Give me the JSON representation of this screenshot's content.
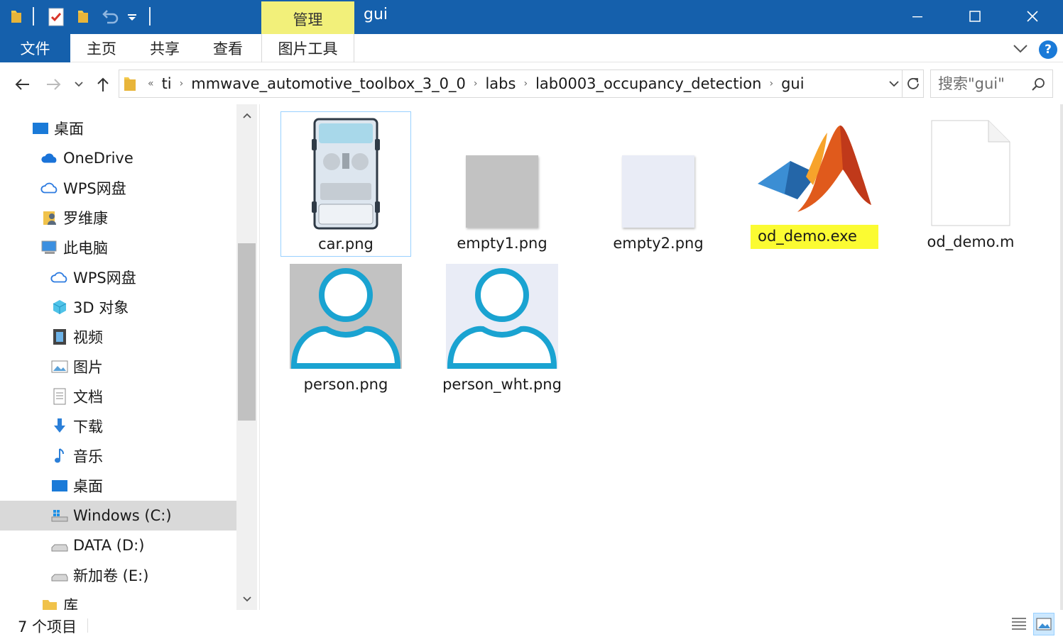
{
  "window": {
    "title": "gui",
    "context_tab": "管理",
    "minimize": "—",
    "maximize": "☐",
    "close": "✕"
  },
  "ribbon": {
    "file": "文件",
    "tabs": [
      "主页",
      "共享",
      "查看"
    ],
    "picture_tools": "图片工具",
    "help": "?"
  },
  "address": {
    "overflow": "«",
    "crumbs": [
      "ti",
      "mmwave_automotive_toolbox_3_0_0",
      "labs",
      "lab0003_occupancy_detection",
      "gui"
    ]
  },
  "search": {
    "placeholder": "搜索\"gui\""
  },
  "nav": {
    "items": [
      {
        "label": "桌面",
        "icon": "desktop-icon"
      },
      {
        "label": "OneDrive",
        "icon": "onedrive-cloud-icon"
      },
      {
        "label": "WPS网盘",
        "icon": "wps-cloud-icon"
      },
      {
        "label": "罗维康",
        "icon": "user-folder-icon"
      },
      {
        "label": "此电脑",
        "icon": "this-pc-icon"
      },
      {
        "label": "WPS网盘",
        "icon": "wps-cloud-icon"
      },
      {
        "label": "3D 对象",
        "icon": "3d-objects-icon"
      },
      {
        "label": "视频",
        "icon": "videos-icon"
      },
      {
        "label": "图片",
        "icon": "pictures-icon"
      },
      {
        "label": "文档",
        "icon": "documents-icon"
      },
      {
        "label": "下载",
        "icon": "downloads-icon"
      },
      {
        "label": "音乐",
        "icon": "music-icon"
      },
      {
        "label": "桌面",
        "icon": "desktop-icon"
      },
      {
        "label": "Windows (C:)",
        "icon": "windows-drive-icon"
      },
      {
        "label": "DATA (D:)",
        "icon": "drive-icon"
      },
      {
        "label": "新加卷 (E:)",
        "icon": "drive-icon"
      },
      {
        "label": "库",
        "icon": "library-icon"
      }
    ],
    "selected": "Windows (C:)"
  },
  "files": [
    {
      "name": "car.png",
      "icon": "car-thumbnail"
    },
    {
      "name": "empty1.png",
      "icon": "gray-thumbnail"
    },
    {
      "name": "empty2.png",
      "icon": "light-thumbnail"
    },
    {
      "name": "od_demo.exe",
      "icon": "matlab-icon"
    },
    {
      "name": "od_demo.m",
      "icon": "blank-document-icon"
    },
    {
      "name": "person.png",
      "icon": "person-gray-thumbnail"
    },
    {
      "name": "person_wht.png",
      "icon": "person-white-thumbnail"
    }
  ],
  "status": {
    "count": "7 个项目"
  },
  "colors": {
    "titlebar": "#1560ac",
    "context_tab": "#f2f07a",
    "highlight": "#fbfb32",
    "selection_border": "#99d1ff",
    "person_stroke": "#1aa3d1"
  }
}
